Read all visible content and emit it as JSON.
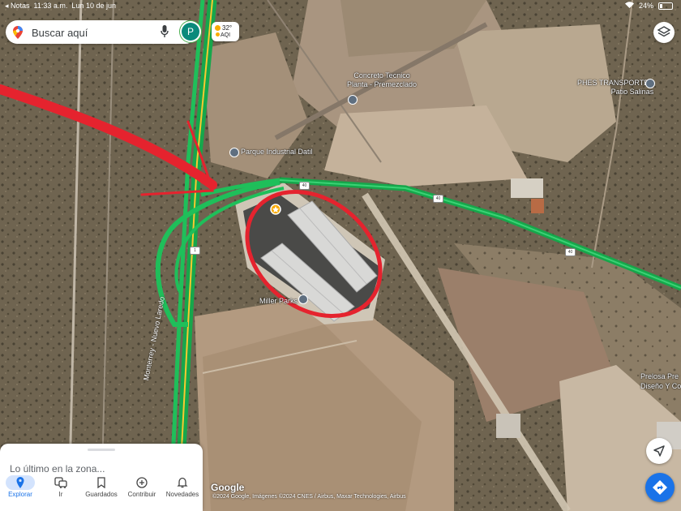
{
  "status_bar": {
    "back_app": "◂ Notas",
    "time": "11:33 a.m.",
    "date": "Lun 10 de jun",
    "battery": "24%"
  },
  "search": {
    "placeholder": "Buscar aquí",
    "avatar_letter": "P"
  },
  "weather": {
    "temp": "32°",
    "aqi": "AQI"
  },
  "map_labels": {
    "concreto": "Concreto Tecnico\nPlanta - Premezclado",
    "phes": "PHES TRANSPORTES\nPatio Salinas",
    "parque": "Parque Industrial Datil",
    "miller": "Miller Parks",
    "prelosa": "Prelosa Pre\nDiseño Y Co",
    "highway": "Monterrey - Nuevo Laredo",
    "shield_40": "40",
    "shield_1": "1"
  },
  "sheet": {
    "title": "Lo último en la zona..."
  },
  "nav": [
    {
      "label": "Explorar",
      "icon": "location-pin-icon",
      "active": true
    },
    {
      "label": "Ir",
      "icon": "commute-icon",
      "active": false
    },
    {
      "label": "Guardados",
      "icon": "bookmark-icon",
      "active": false
    },
    {
      "label": "Contribuir",
      "icon": "add-circle-icon",
      "active": false
    },
    {
      "label": "Novedades",
      "icon": "bell-icon",
      "active": false
    }
  ],
  "attribution": {
    "logo": "Google",
    "credits": "©2024 Google, Imágenes ©2024 CNES / Airbus, Maxar Technologies, Airbus"
  },
  "colors": {
    "traffic_green": "#1fbf5a",
    "annotation_red": "#e5232e",
    "accent": "#1a73e8"
  }
}
